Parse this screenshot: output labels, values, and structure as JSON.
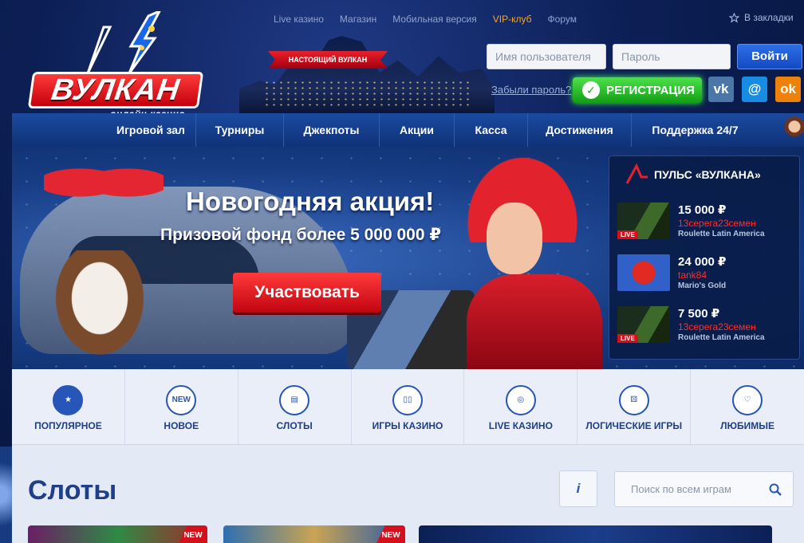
{
  "header": {
    "logo_text": "ВУЛКАН",
    "logo_sub": "онлайн казино",
    "ribbon": "НАСТОЯЩИЙ ВУЛКАН",
    "top_links": [
      "Live казино",
      "Магазин",
      "Мобильная версия",
      "VIP-клуб",
      "Форум"
    ],
    "bookmark": "В закладки",
    "username_placeholder": "Имя пользователя",
    "password_placeholder": "Пароль",
    "login_label": "Войти",
    "forgot_label": "Забыли пароль?",
    "register_label": "РЕГИСТРАЦИЯ",
    "social": {
      "vk": "vk",
      "mail": "@",
      "ok": "ok"
    }
  },
  "nav": {
    "items": [
      "Игровой зал",
      "Турниры",
      "Джекпоты",
      "Акции",
      "Касса",
      "Достижения",
      "Поддержка 24/7"
    ]
  },
  "banner": {
    "title": "Новогодняя акция!",
    "subtitle": "Призовой фонд более 5 000 000 ₽",
    "cta": "Участвовать"
  },
  "pulse": {
    "title": "ПУЛЬС «ВУЛКАНА»",
    "wins": [
      {
        "amount": "15 000 ₽",
        "user": "13серега23семен",
        "game": "Roulette Latin America",
        "live": "LIVE"
      },
      {
        "amount": "24 000 ₽",
        "user": "tank84",
        "game": "Mario's Gold",
        "live": ""
      },
      {
        "amount": "7 500 ₽",
        "user": "13серега23семен",
        "game": "Roulette Latin America",
        "live": "LIVE"
      }
    ]
  },
  "categories": [
    {
      "label": "ПОПУЛЯРНОЕ",
      "icon": "star-icon",
      "icon_text": "★"
    },
    {
      "label": "НОВОЕ",
      "icon": "new-icon",
      "icon_text": "NEW"
    },
    {
      "label": "СЛОТЫ",
      "icon": "slot-icon",
      "icon_text": "▤"
    },
    {
      "label": "ИГРЫ КАЗИНО",
      "icon": "cards-icon",
      "icon_text": "▯▯"
    },
    {
      "label": "LIVE КАЗИНО",
      "icon": "chip-icon",
      "icon_text": "◎"
    },
    {
      "label": "ЛОГИЧЕСКИЕ ИГРЫ",
      "icon": "dice-icon",
      "icon_text": "⚄"
    },
    {
      "label": "ЛЮБИМЫЕ",
      "icon": "heart-icon",
      "icon_text": "♡"
    }
  ],
  "slots": {
    "title": "Слоты",
    "info_label": "i",
    "search_placeholder": "Поиск по всем играм",
    "new_badge": "NEW"
  },
  "colors": {
    "accent": "#2756b8",
    "register": "#129d15",
    "cta": "#c10410",
    "vip": "#f5a623"
  }
}
